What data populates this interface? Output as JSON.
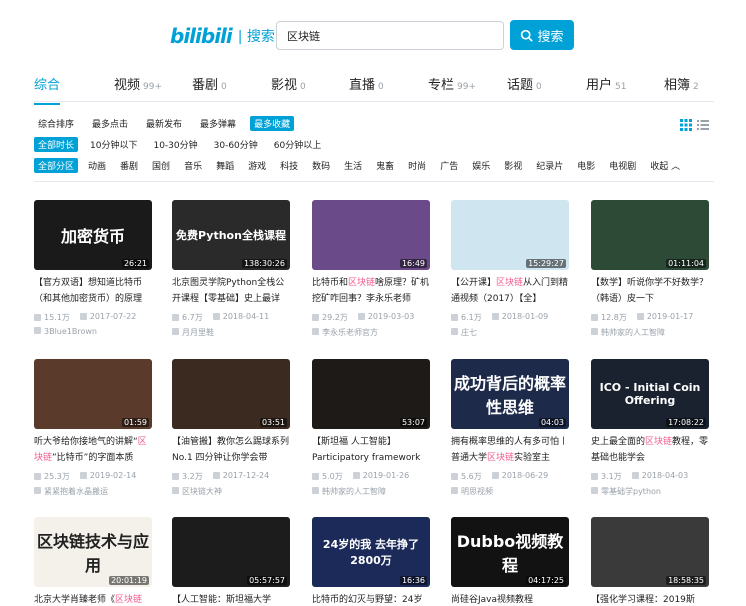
{
  "header": {
    "brand": "bilibili",
    "sep": "| 搜索",
    "search_value": "区块链",
    "search_button": "搜索"
  },
  "tabs": [
    {
      "label": "综合",
      "count": "",
      "active": true
    },
    {
      "label": "视频",
      "count": "99+"
    },
    {
      "label": "番剧",
      "count": "0"
    },
    {
      "label": "影视",
      "count": "0"
    },
    {
      "label": "直播",
      "count": "0"
    },
    {
      "label": "专栏",
      "count": "99+"
    },
    {
      "label": "话题",
      "count": "0"
    },
    {
      "label": "用户",
      "count": "51"
    },
    {
      "label": "相簿",
      "count": "2"
    }
  ],
  "sort_filters": [
    "综合排序",
    "最多点击",
    "最新发布",
    "最多弹幕",
    "最多收藏"
  ],
  "sort_selected": 4,
  "duration_filters": [
    "全部时长",
    "10分钟以下",
    "10-30分钟",
    "30-60分钟",
    "60分钟以上"
  ],
  "duration_selected": 0,
  "zone_filters": [
    "全部分区",
    "动画",
    "番剧",
    "国创",
    "音乐",
    "舞蹈",
    "游戏",
    "科技",
    "数码",
    "生活",
    "鬼畜",
    "时尚",
    "广告",
    "娱乐",
    "影视",
    "纪录片",
    "电影",
    "电视剧",
    "收起 ︿"
  ],
  "zone_selected": 0,
  "accent": "#00a1d6",
  "highlight": "#f25d8e",
  "videos": [
    {
      "thumb_text": "加密货币",
      "bg": "#1a1a1a",
      "dur": "26:21",
      "t1": "【官方双语】想知道比特币（和其他加密货币）的原理",
      "hl": "",
      "t2": "",
      "views": "15.1万",
      "date": "2017-07-22",
      "up": "3Blue1Brown"
    },
    {
      "thumb_text": "免费Python全栈课程",
      "bg": "#2a2a2a",
      "dur": "138:30:26",
      "t1": "北京图灵学院Python全栈公开课程【零基础】史上最详",
      "hl": "",
      "t2": "",
      "views": "6.7万",
      "date": "2018-04-11",
      "up": "月月里鞋"
    },
    {
      "thumb_text": "",
      "bg": "#6b4a8a",
      "dur": "16:49",
      "t1": "比特币和",
      "hl": "区块链",
      "t2": "啥原理？矿机挖矿咋回事？李永乐老师",
      "views": "29.2万",
      "date": "2019-03-03",
      "up": "李永乐老师官方"
    },
    {
      "thumb_text": "",
      "bg": "#cfe5f0",
      "dur": "15:29:27",
      "t1": "【公开课】",
      "hl": "区块链",
      "t2": "从入门到精通视频（2017）【全】",
      "views": "6.1万",
      "date": "2018-01-09",
      "up": "庄七"
    },
    {
      "thumb_text": "",
      "bg": "#2d4a36",
      "dur": "01:11:04",
      "t1": "【数学】听说你学不好数学？（韩语）皮一下",
      "hl": "",
      "t2": "",
      "views": "12.8万",
      "date": "2019-01-17",
      "up": "韩帅家的人工智障"
    },
    {
      "thumb_text": "",
      "bg": "#5a3a2a",
      "dur": "01:59",
      "t1": "听大爷给你接地气的讲解“",
      "hl": "区块链",
      "t2": "”比特币”的字面本质",
      "views": "25.3万",
      "date": "2019-02-14",
      "up": "紧紧抱着水晶搬运"
    },
    {
      "thumb_text": "",
      "bg": "#3a2a20",
      "dur": "03:51",
      "t1": "【油管搬】教你怎么踢球系列No.1 四分钟让你学会带",
      "hl": "",
      "t2": "",
      "views": "3.2万",
      "date": "2017-12-24",
      "up": "区块链大神"
    },
    {
      "thumb_text": "",
      "bg": "#1e1a18",
      "dur": "53:07",
      "t1": "【斯坦福 人工智能】Participatory framework for",
      "hl": "",
      "t2": "",
      "views": "5.0万",
      "date": "2019-01-26",
      "up": "韩帅家的人工智障"
    },
    {
      "thumb_text": "成功背后的概率性思维",
      "bg": "#1d2a4a",
      "dur": "04:03",
      "t1": "拥有概率思维的人有多可怕丨普通大学",
      "hl": "区块链",
      "t2": "实验室主",
      "views": "5.6万",
      "date": "2018-06-29",
      "up": "明思视频"
    },
    {
      "thumb_text": "ICO - Initial Coin Offering",
      "bg": "#1a2230",
      "dur": "17:08:22",
      "t1": "史上最全面的",
      "hl": "区块链",
      "t2": "教程，零基础也能学会",
      "views": "3.1万",
      "date": "2018-04-03",
      "up": "零基础学python"
    },
    {
      "thumb_text": "区块链技术与应用",
      "bg": "#f4f1ea",
      "dur": "20:01:19",
      "t1": "北京大学肖臻老师《",
      "hl": "区块链",
      "t2": "",
      "views": "",
      "date": "",
      "up": ""
    },
    {
      "thumb_text": "",
      "bg": "#1c1c1c",
      "dur": "05:57:57",
      "t1": "【人工智能：斯坦福大学",
      "hl": "",
      "t2": "",
      "views": "",
      "date": "",
      "up": ""
    },
    {
      "thumb_text": "24岁的我 去年挣了2800万",
      "bg": "#1c2a5a",
      "dur": "16:36",
      "t1": "比特币的幻灭与野望：24岁",
      "hl": "",
      "t2": "",
      "views": "",
      "date": "",
      "up": ""
    },
    {
      "thumb_text": "Dubbo视频教程",
      "bg": "#121212",
      "dur": "04:17:25",
      "t1": "尚硅谷Java视频教程",
      "hl": "",
      "t2": "",
      "views": "",
      "date": "",
      "up": ""
    },
    {
      "thumb_text": "",
      "bg": "#3a3a3a",
      "dur": "18:58:35",
      "t1": "【强化学习课程：2019斯",
      "hl": "",
      "t2": "",
      "views": "",
      "date": "",
      "up": ""
    }
  ]
}
